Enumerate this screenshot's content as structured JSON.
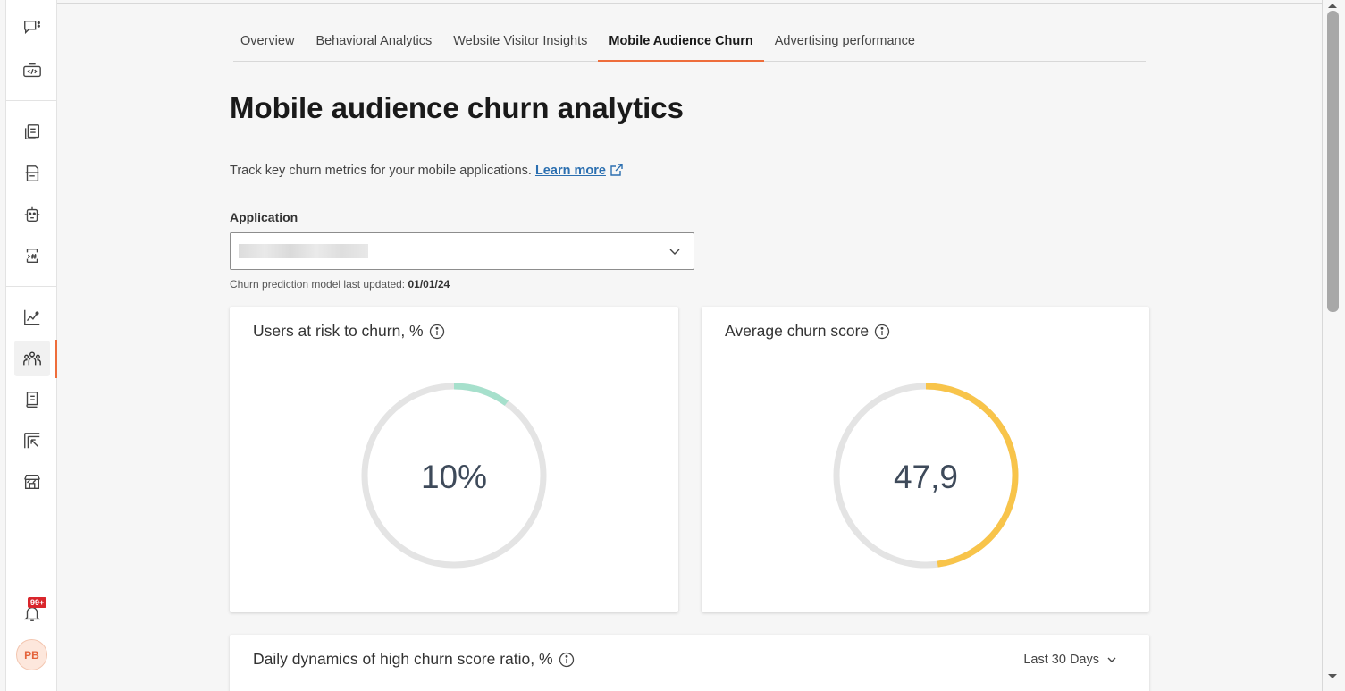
{
  "tabs": [
    {
      "label": "Overview"
    },
    {
      "label": "Behavioral Analytics"
    },
    {
      "label": "Website Visitor Insights"
    },
    {
      "label": "Mobile Audience Churn"
    },
    {
      "label": "Advertising performance"
    }
  ],
  "active_tab": "Mobile Audience Churn",
  "page_title": "Mobile audience churn analytics",
  "description": "Track key churn metrics for your mobile applications.",
  "learn_more": "Learn more",
  "application": {
    "label": "Application",
    "value": ""
  },
  "model_update": {
    "label": "Churn prediction model last updated:",
    "date": "01/01/24"
  },
  "cards": {
    "users_at_risk": {
      "title": "Users at risk to churn, %",
      "value": "10%",
      "fraction": 0.1,
      "color": "#a6e0cc"
    },
    "avg_churn_score": {
      "title": "Average churn score",
      "value": "47,9",
      "fraction": 0.479,
      "color": "#f8c44a"
    },
    "daily_dynamics": {
      "title": "Daily dynamics of high churn score ratio, %",
      "range": "Last 30 Days"
    }
  },
  "notifications": {
    "badge": "99+"
  },
  "user": {
    "initials": "PB"
  },
  "colors": {
    "accent": "#ee6d3b",
    "link": "#2b6fb0",
    "track": "#e4e4e4"
  }
}
